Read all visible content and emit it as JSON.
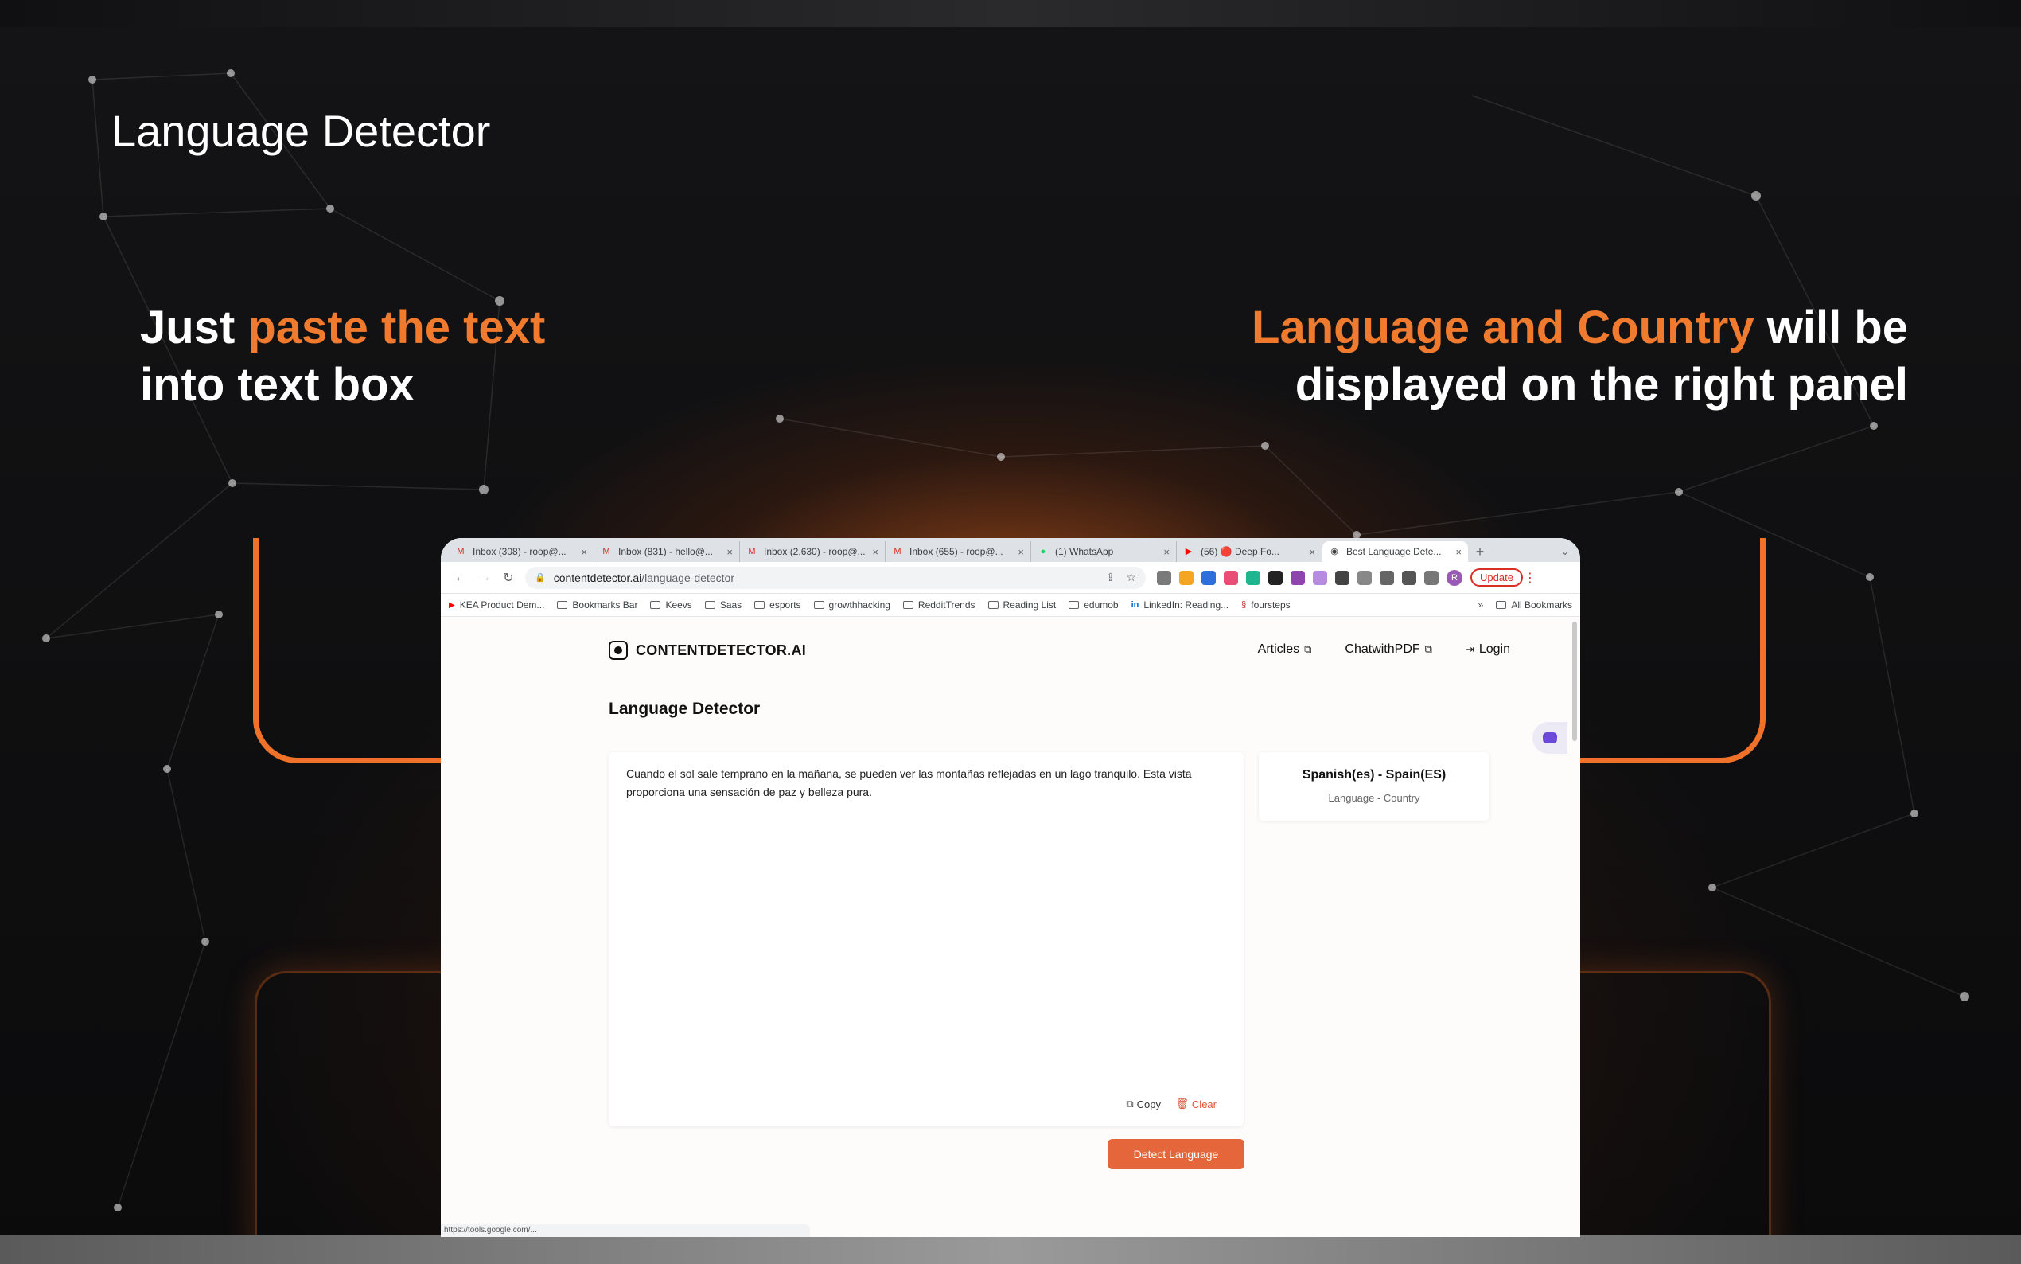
{
  "slide": {
    "heading": "Language Detector",
    "left_callout": {
      "part1": "Just ",
      "highlight": "paste the text",
      "part2": " into text box"
    },
    "right_callout": {
      "highlight": "Language and Country",
      "part2": " will be displayed on the right panel"
    },
    "accent_color": "#f0722a"
  },
  "browser": {
    "tabs": [
      {
        "icon": "gmail-icon",
        "label": "Inbox (308) - roop@..."
      },
      {
        "icon": "gmail-icon",
        "label": "Inbox (831) - hello@..."
      },
      {
        "icon": "gmail-icon",
        "label": "Inbox (2,630) - roop@..."
      },
      {
        "icon": "gmail-icon",
        "label": "Inbox (655) - roop@..."
      },
      {
        "icon": "whatsapp-icon",
        "label": "(1) WhatsApp"
      },
      {
        "icon": "youtube-icon",
        "label": "(56) 🔴 Deep Fo..."
      },
      {
        "icon": "contentdetector-icon",
        "label": "Best Language Dete..."
      }
    ],
    "new_tab_label": "+",
    "tab_menu_label": "⌄",
    "url_domain": "contentdetector.ai",
    "url_path": "/language-detector",
    "update_label": "Update",
    "avatar_initial": "R",
    "bookmarks": [
      "KEA Product Dem...",
      "Bookmarks Bar",
      "Keevs",
      "Saas",
      "esports",
      "growthhacking",
      "RedditTrends",
      "Reading List",
      "edumob",
      "LinkedIn: Reading...",
      "foursteps"
    ],
    "bookmarks_more": "»",
    "all_bookmarks": "All Bookmarks",
    "status_url": "https://tools.google.com/..."
  },
  "site": {
    "logo_text": "CONTENTDETECTOR.AI",
    "nav": {
      "articles": "Articles",
      "chatwithpdf": "ChatwithPDF",
      "login": "Login"
    },
    "page_title": "Language Detector",
    "input_text": "Cuando el sol sale temprano en la mañana, se pueden ver las montañas reflejadas en un lago tranquilo. Esta vista proporciona una sensación de paz y belleza pura.",
    "copy_label": "Copy",
    "clear_label": "Clear",
    "result_value": "Spanish(es) - Spain(ES)",
    "result_label": "Language - Country",
    "detect_button": "Detect Language"
  }
}
